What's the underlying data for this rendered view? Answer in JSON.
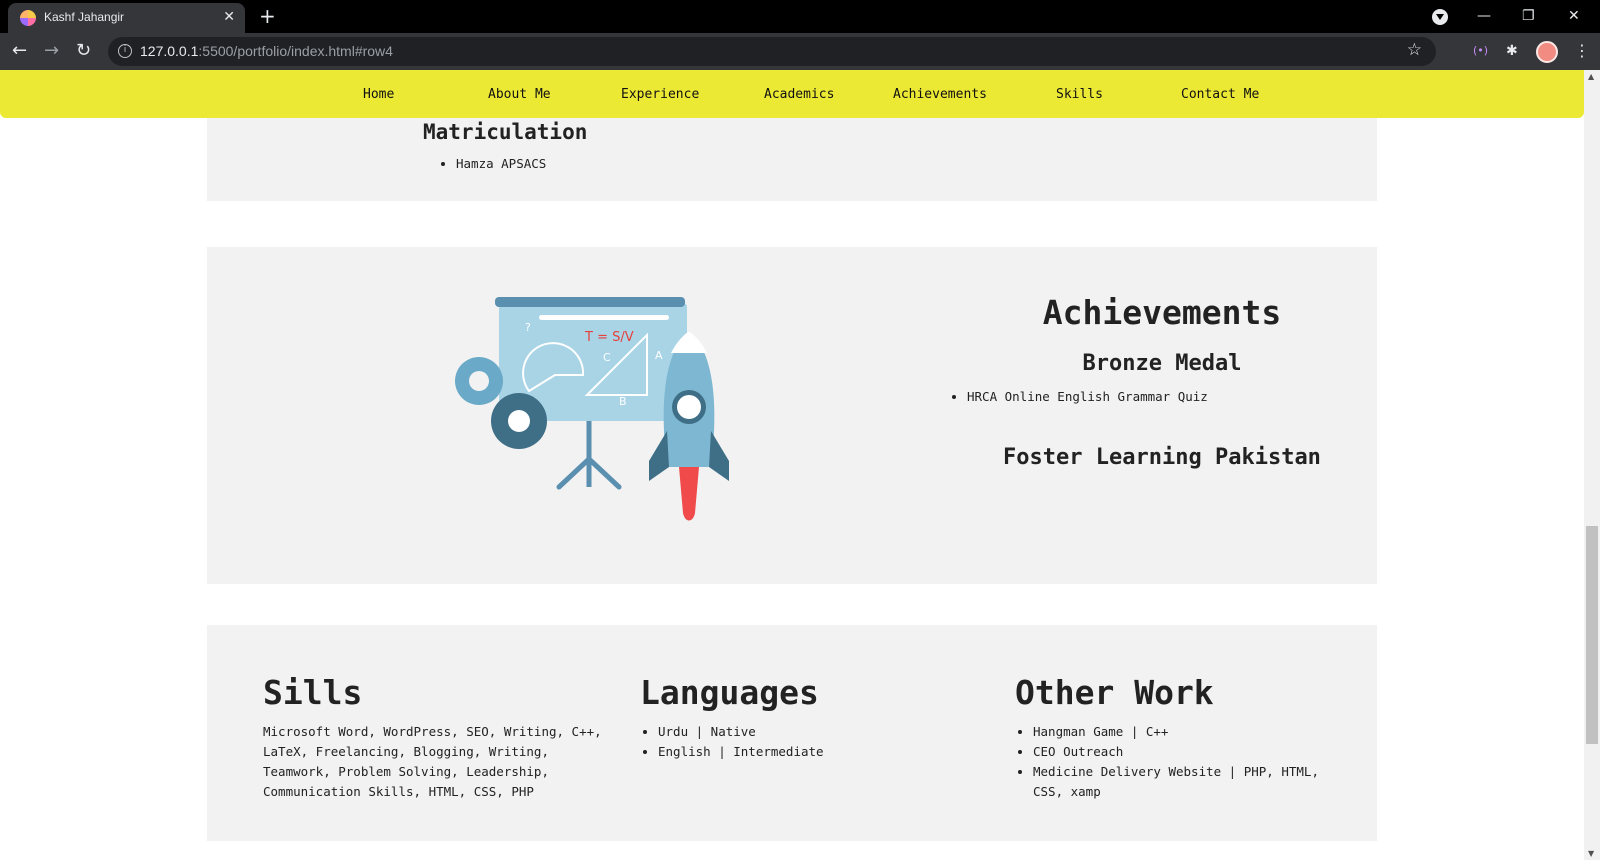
{
  "browser": {
    "tab_title": "Kashf Jahangir",
    "tab_close": "✕",
    "new_tab": "+",
    "url_host": "127.0.0.1",
    "url_rest": ":5500/portfolio/index.html#row4",
    "icons": {
      "back": "←",
      "forward": "→",
      "reload": "↻",
      "star": "☆",
      "extension": "✱",
      "menu": "⋮",
      "minimize": "—",
      "restore": "❐",
      "close": "✕",
      "cast": "(•)"
    }
  },
  "nav": {
    "items": [
      {
        "label": "Home"
      },
      {
        "label": "About Me"
      },
      {
        "label": "Experience"
      },
      {
        "label": "Academics"
      },
      {
        "label": "Achievements"
      },
      {
        "label": "Skills"
      },
      {
        "label": "Contact Me"
      }
    ]
  },
  "academics": {
    "title": "Matriculation",
    "items": [
      "Hamza APSACS"
    ]
  },
  "achievements": {
    "title": "Achievements",
    "award1_title": "Bronze Medal",
    "award1_items": [
      "HRCA Online English Grammar Quiz"
    ],
    "award2_title": "Foster Learning Pakistan",
    "illustration": {
      "formula": "T = S/V",
      "letter_a": "A",
      "letter_b": "B",
      "letter_c": "C",
      "question": "?"
    }
  },
  "skills": {
    "title": "Sills",
    "text": "Microsoft Word, WordPress, SEO, Writing, C++, LaTeX, Freelancing, Blogging, Writing, Teamwork, Problem Solving, Leadership, Communication Skills, HTML, CSS, PHP"
  },
  "languages": {
    "title": "Languages",
    "items": [
      "Urdu | Native",
      "English | Intermediate"
    ]
  },
  "other_work": {
    "title": "Other Work",
    "items": [
      "Hangman Game | C++",
      "CEO Outreach",
      "Medicine Delivery Website | PHP, HTML, CSS, xamp"
    ]
  },
  "colors": {
    "navbar": "#ece935",
    "card": "#f2f2f2",
    "chrome_dark": "#000000",
    "toolbar": "#35363a"
  }
}
